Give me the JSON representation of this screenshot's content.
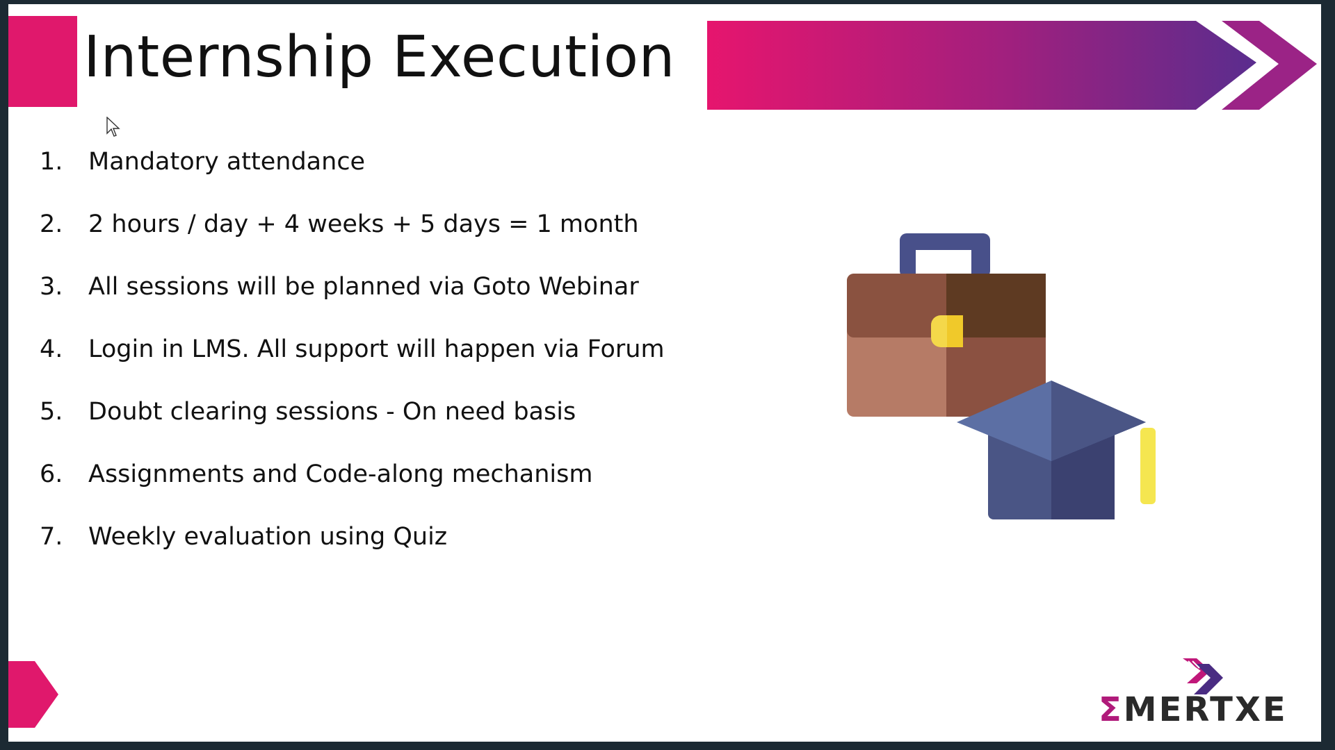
{
  "slide": {
    "title": "Internship Execution",
    "items": [
      {
        "number": "1.",
        "text": "Mandatory attendance"
      },
      {
        "number": "2.",
        "text": "2 hours / day + 4 weeks + 5 days = 1 month"
      },
      {
        "number": "3.",
        "text": "All sessions will be planned via Goto Webinar"
      },
      {
        "number": "4.",
        "text": "Login in LMS. All support will happen via Forum"
      },
      {
        "number": "5.",
        "text": "Doubt clearing sessions - On need basis"
      },
      {
        "number": "6.",
        "text": "Assignments and Code-along mechanism"
      },
      {
        "number": "7.",
        "text": "Weekly evaluation using Quiz"
      }
    ]
  },
  "logo": {
    "sigma": "Σ",
    "text": "MERTXE"
  },
  "icons": {
    "illustration": "briefcase-and-graduation-cap-icon",
    "corner": "arrow-right-icon",
    "cursor": "mouse-pointer-icon"
  },
  "colors": {
    "accent": "#e0186c",
    "gradient_start": "#e6156e",
    "gradient_end": "#5a2d8e",
    "text": "#111111",
    "frame": "#1c2a33"
  }
}
